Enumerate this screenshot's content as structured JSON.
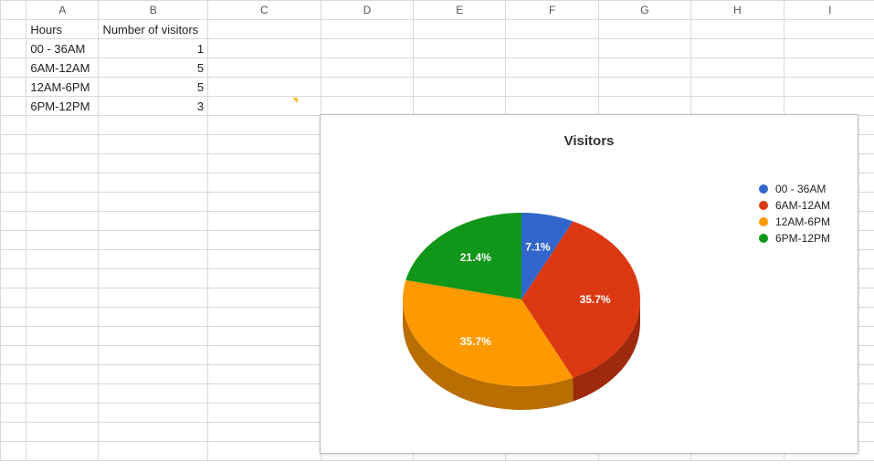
{
  "sheet": {
    "column_headers": [
      "A",
      "B",
      "C",
      "D",
      "E",
      "F",
      "G",
      "H",
      "I"
    ],
    "header_row": {
      "a": "Hours",
      "b": "Number of visitors"
    },
    "rows": [
      {
        "a": "00 - 36AM",
        "b": "1"
      },
      {
        "a": "6AM-12AM",
        "b": "5"
      },
      {
        "a": "12AM-6PM",
        "b": "5"
      },
      {
        "a": "6PM-12PM",
        "b": "3"
      }
    ]
  },
  "chart_data": {
    "type": "pie",
    "title": "Visitors",
    "categories": [
      "00 - 36AM",
      "6AM-12AM",
      "12AM-6PM",
      "6PM-12PM"
    ],
    "values": [
      1,
      5,
      5,
      3
    ],
    "percent_labels": [
      "7.1%",
      "35.7%",
      "35.7%",
      "21.4%"
    ],
    "colors": [
      "#3366CC",
      "#DC3912",
      "#FF9900",
      "#109618"
    ],
    "legend_position": "right",
    "style": "3d"
  }
}
